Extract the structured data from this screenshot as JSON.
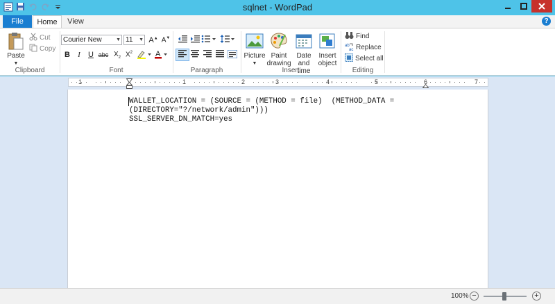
{
  "window": {
    "title": "sqlnet - WordPad"
  },
  "tabs": {
    "file": "File",
    "home": "Home",
    "view": "View"
  },
  "clipboard": {
    "label": "Clipboard",
    "paste": "Paste",
    "cut": "Cut",
    "copy": "Copy"
  },
  "font": {
    "label": "Font",
    "family": "Courier New",
    "size": "11"
  },
  "paragraph": {
    "label": "Paragraph"
  },
  "insert": {
    "label": "Insert",
    "picture": "Picture",
    "paint_1": "Paint",
    "paint_2": "drawing",
    "datetime_1": "Date and",
    "datetime_2": "time",
    "object_1": "Insert",
    "object_2": "object"
  },
  "editing": {
    "label": "Editing",
    "find": "Find",
    "replace": "Replace",
    "select_all": "Select all"
  },
  "ruler": {
    "marks": [
      "1",
      "1",
      "2",
      "3",
      "4",
      "5",
      "6",
      "7"
    ]
  },
  "document": {
    "lines": [
      "WALLET_LOCATION = (SOURCE = (METHOD = file)  (METHOD_DATA =",
      "(DIRECTORY=\"?/network/admin\")))",
      "SSL_SERVER_DN_MATCH=yes"
    ]
  },
  "status": {
    "zoom": "100%"
  },
  "colors": {
    "accent": "#1a7ed1",
    "titlebar": "#4ec3e8",
    "close": "#c7312b",
    "doc_bg": "#dae6f5"
  }
}
